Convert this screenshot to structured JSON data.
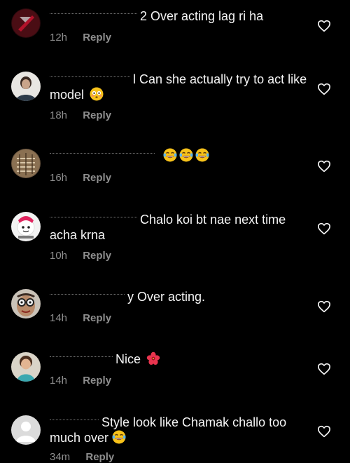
{
  "reply_label": "Reply",
  "colors": {
    "background": "#000000",
    "text": "#f5f5f5",
    "muted": "#8e8e8e",
    "heart_stroke": "#f5f5f5"
  },
  "comments": [
    {
      "text": "2 Over acting lag ri ha",
      "time": "12h",
      "avatar": "dark-red-avatar",
      "emojis": []
    },
    {
      "text": "l Can she actually try to act like model",
      "time": "18h",
      "avatar": "person-photo-avatar",
      "emojis": [
        "flushed-face-emoji"
      ]
    },
    {
      "text": "",
      "time": "16h",
      "avatar": "brown-pattern-avatar",
      "emojis": [
        "laughing-tears-emoji",
        "laughing-tears-emoji",
        "laughing-tears-emoji"
      ]
    },
    {
      "text": "Chalo koi bt nae next time acha krna",
      "time": "10h",
      "avatar": "cartoon-avatar",
      "emojis": []
    },
    {
      "text": "y Over acting.",
      "time": "14h",
      "avatar": "glasses-face-avatar",
      "emojis": []
    },
    {
      "text": "Nice",
      "time": "14h",
      "avatar": "child-photo-avatar",
      "emojis": [
        "hibiscus-emoji"
      ]
    },
    {
      "text": "Style look like Chamak challo too much over",
      "time": "34m",
      "avatar": "default-avatar",
      "emojis": [
        "laughing-tears-emoji"
      ]
    }
  ]
}
